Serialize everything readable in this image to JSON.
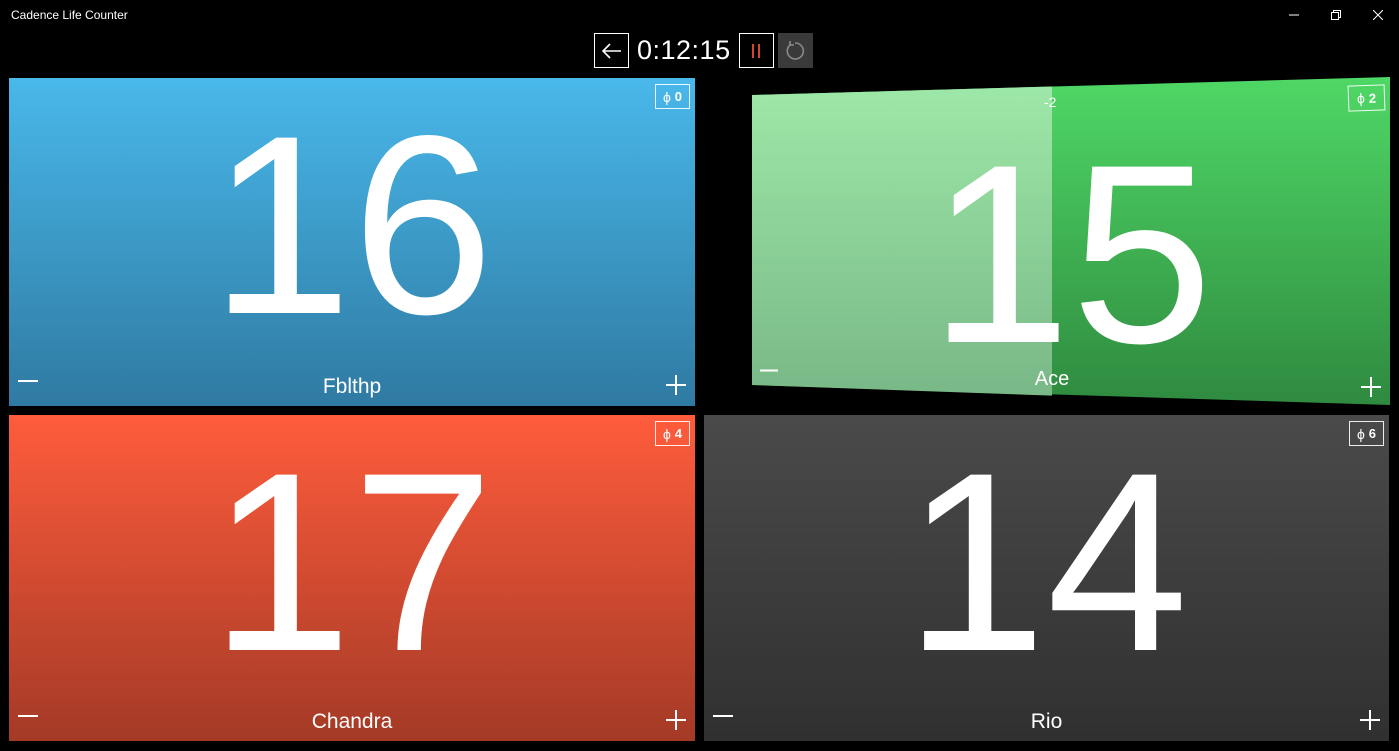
{
  "window": {
    "title": "Cadence Life Counter"
  },
  "toolbar": {
    "timer": "0:12:15"
  },
  "players": [
    {
      "name": "Fblthp",
      "life": "16",
      "poison": "0",
      "color": "#3ea0d4"
    },
    {
      "name": "Ace",
      "life": "15",
      "poison": "2",
      "delta": "-2",
      "color": "#3fc05a"
    },
    {
      "name": "Chandra",
      "life": "17",
      "poison": "4",
      "color": "#e8503a"
    },
    {
      "name": "Rio",
      "life": "14",
      "poison": "6",
      "color": "#3f3f3f"
    }
  ],
  "poison_symbol": "ϕ",
  "colors": {
    "pause_accent": "#e8503a",
    "background": "#000000"
  }
}
